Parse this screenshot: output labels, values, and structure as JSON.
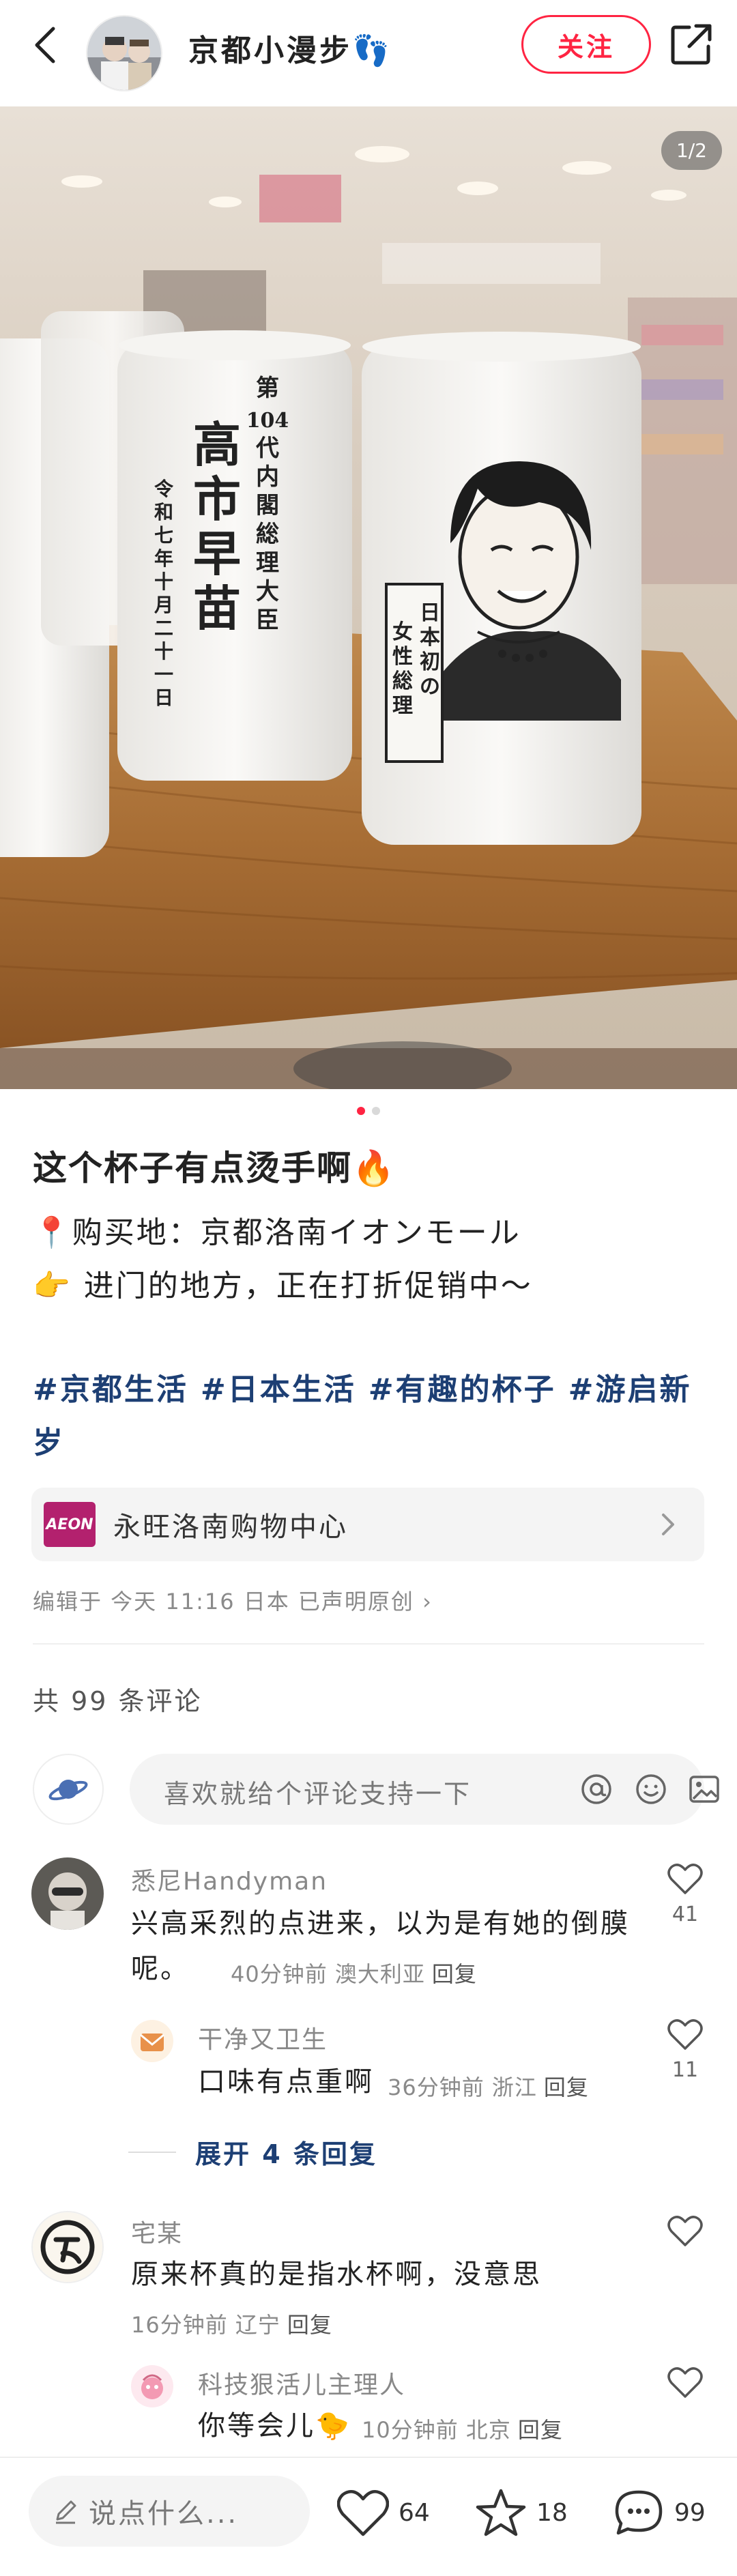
{
  "header": {
    "author_name": "京都小漫步👣",
    "follow_label": "关注"
  },
  "photo": {
    "page_indicator": "1/2",
    "mug_left_lines": [
      "第",
      "104",
      "代",
      "内",
      "閣",
      "総",
      "理",
      "大",
      "臣"
    ],
    "mug_left_name": [
      "高",
      "市",
      "早",
      "苗"
    ],
    "mug_left_date": [
      "令",
      "和",
      "七",
      "年",
      "十",
      "月",
      "二",
      "十",
      "一",
      "日"
    ],
    "mug_right_scroll": [
      "日本初の",
      "女性総理"
    ]
  },
  "post": {
    "title": "这个杯子有点烫手啊🔥",
    "line1": "📍购买地：京都洛南イオンモール",
    "line2": "👉 进门的地方，正在打折促销中～",
    "tags": [
      "#京都生活",
      "#日本生活",
      "#有趣的杯子",
      "#游启新岁"
    ],
    "location_logo": "AEON",
    "location": "永旺洛南购物中心",
    "meta": "编辑于 今天 11:16 日本 已声明原创"
  },
  "comments_section": {
    "count_label": "共 99 条评论",
    "input_placeholder": "喜欢就给个评论支持一下",
    "comments": [
      {
        "name": "悉尼Handyman",
        "text": "兴高采烈的点进来，以为是有她的倒膜呢。",
        "time_loc": "40分钟前 澳大利亚",
        "reply": "回复",
        "likes": "41"
      },
      {
        "name": "干净又卫生",
        "text": "口味有点重啊",
        "time_loc": "36分钟前 浙江",
        "reply": "回复",
        "likes": "11"
      },
      {
        "name": "宅某",
        "text": "原来杯真的是指水杯啊，没意思",
        "time_loc": "16分钟前 辽宁",
        "reply": "回复",
        "likes": ""
      },
      {
        "name": "科技狠活儿主理人",
        "text": "你等会儿🐤",
        "time_loc": "10分钟前 北京",
        "reply": "回复",
        "likes": ""
      }
    ],
    "expand_label": "展开 4 条回复"
  },
  "bottom_bar": {
    "say_placeholder": "说点什么...",
    "likes": "64",
    "stars": "18",
    "comments": "99"
  },
  "colors": {
    "accent_red": "#ff2442",
    "tag_blue": "#1d3f74",
    "aeon_purple": "#b3216e"
  },
  "icons": [
    "back-arrow-icon",
    "share-icon",
    "pin-icon",
    "chevron-right-icon",
    "planet-icon",
    "at-icon",
    "emoji-icon",
    "image-icon",
    "heart-icon",
    "star-icon",
    "comment-bubble-icon",
    "pencil-icon"
  ]
}
